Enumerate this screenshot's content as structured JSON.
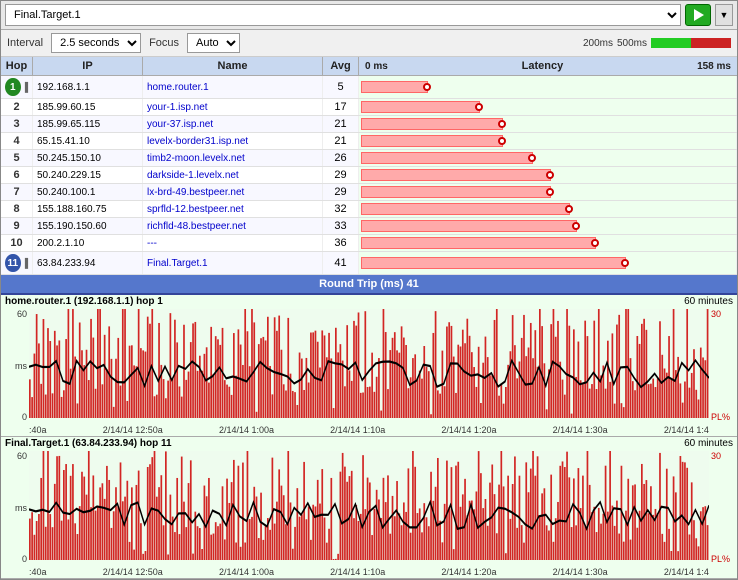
{
  "header": {
    "target_value": "Final.Target.1",
    "play_label": "▶",
    "dropdown_label": "▼"
  },
  "toolbar": {
    "interval_label": "Interval",
    "interval_value": "2.5 seconds",
    "focus_label": "Focus",
    "focus_value": "Auto",
    "scale_200": "200ms",
    "scale_500": "500ms"
  },
  "table": {
    "headers": [
      "Hop",
      "IP",
      "Name",
      "Avg",
      "0 ms",
      "Latency",
      "158 ms"
    ],
    "latency_min": "0 ms",
    "latency_max": "158 ms",
    "round_trip_label": "Round Trip (ms)",
    "round_trip_value": "41",
    "rows": [
      {
        "hop": 1,
        "hop_special": true,
        "ip": "192.168.1.1",
        "name": "home.router.1",
        "avg": 5,
        "bar_pct": 18
      },
      {
        "hop": 2,
        "ip": "185.99.60.15",
        "name": "your-1.isp.net",
        "avg": 17,
        "bar_pct": 32
      },
      {
        "hop": 3,
        "ip": "185.99.65.115",
        "name": "your-37.isp.net",
        "avg": 21,
        "bar_pct": 38
      },
      {
        "hop": 4,
        "ip": "65.15.41.10",
        "name": "levelx-border31.isp.net",
        "avg": 21,
        "bar_pct": 38
      },
      {
        "hop": 5,
        "ip": "50.245.150.10",
        "name": "timb2-moon.levelx.net",
        "avg": 26,
        "bar_pct": 46
      },
      {
        "hop": 6,
        "ip": "50.240.229.15",
        "name": "darkside-1.levelx.net",
        "avg": 29,
        "bar_pct": 51
      },
      {
        "hop": 7,
        "ip": "50.240.100.1",
        "name": "lx-brd-49.bestpeer.net",
        "avg": 29,
        "bar_pct": 51
      },
      {
        "hop": 8,
        "ip": "155.188.160.75",
        "name": "sprfld-12.bestpeer.net",
        "avg": 32,
        "bar_pct": 56
      },
      {
        "hop": 9,
        "ip": "155.190.150.60",
        "name": "richfld-48.bestpeer.net",
        "avg": 33,
        "bar_pct": 58
      },
      {
        "hop": 10,
        "ip": "200.2.1.10",
        "name": "---",
        "avg": 36,
        "bar_pct": 63
      },
      {
        "hop": 11,
        "hop_special": true,
        "ip": "63.84.233.94",
        "name": "Final.Target.1",
        "avg": 41,
        "bar_pct": 71
      }
    ]
  },
  "charts": [
    {
      "title": "home.router.1 (192.168.1.1) hop 1",
      "duration": "60 minutes",
      "y_max": "60",
      "y_mid": "ms",
      "y_min": "0",
      "y_right_top": "30",
      "y_right_label": "PL%",
      "x_labels": [
        ":40a",
        "2/14/14 12:50a",
        "2/14/14 1:00a",
        "2/14/14 1:10a",
        "2/14/14 1:20a",
        "2/14/14 1:30a",
        "2/14/14 1:4"
      ]
    },
    {
      "title": "Final.Target.1 (63.84.233.94) hop 11",
      "duration": "60 minutes",
      "y_max": "60",
      "y_mid": "ms",
      "y_min": "0",
      "y_right_top": "30",
      "y_right_label": "PL%",
      "x_labels": [
        ":40a",
        "2/14/14 12:50a",
        "2/14/14 1:00a",
        "2/14/14 1:10a",
        "2/14/14 1:20a",
        "2/14/14 1:30a",
        "2/14/14 1:4"
      ]
    }
  ]
}
